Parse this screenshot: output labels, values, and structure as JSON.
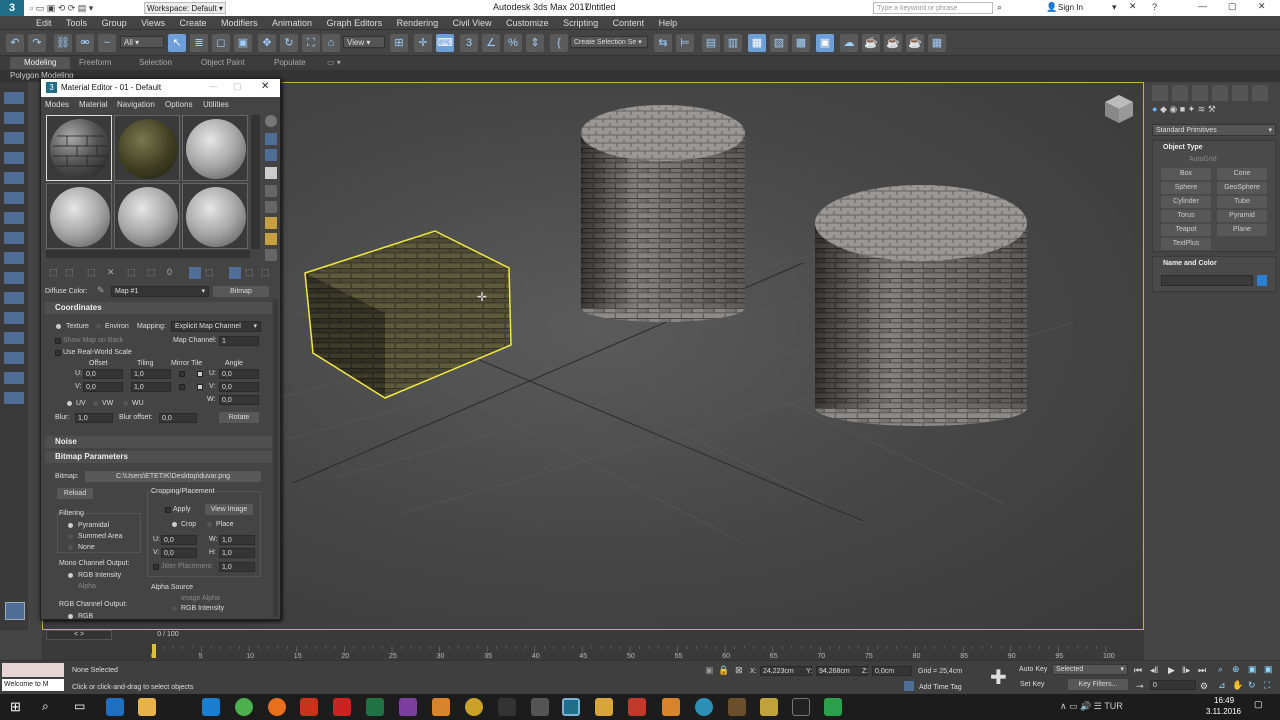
{
  "window": {
    "workspace": "Workspace: Default",
    "app_title": "Autodesk 3ds Max 2017",
    "doc_title": "Untitled",
    "search_placeholder": "Type a keyword or phrase",
    "sign_in": "Sign In"
  },
  "menu": [
    "Edit",
    "Tools",
    "Group",
    "Views",
    "Create",
    "Modifiers",
    "Animation",
    "Graph Editors",
    "Rendering",
    "Civil View",
    "Customize",
    "Scripting",
    "Content",
    "Help"
  ],
  "toolbar": {
    "filter_value": "All",
    "ref_coord": "View",
    "selection_set": "Create Selection Se"
  },
  "ribbon": {
    "tabs": [
      "Modeling",
      "Freeform",
      "Selection",
      "Object Paint",
      "Populate"
    ],
    "sub": "Polygon Modeling"
  },
  "material_editor": {
    "title": "Material Editor - 01 - Default",
    "menus": [
      "Modes",
      "Material",
      "Navigation",
      "Options",
      "Utilities"
    ],
    "diffuse_label": "Diffuse Color:",
    "map_name": "Map #1",
    "map_type": "Bitmap",
    "coordinates": {
      "header": "Coordinates",
      "texture": "Texture",
      "environ": "Environ",
      "mapping_label": "Mapping:",
      "mapping_value": "Explicit Map Channel",
      "show_map_on_back": "Show Map on Back",
      "map_channel_label": "Map Channel:",
      "map_channel_value": "1",
      "use_real_world": "Use Real-World Scale",
      "col_offset": "Offset",
      "col_tiling": "Tiling",
      "col_mirror_tile": "Mirror Tile",
      "col_angle": "Angle",
      "u_label": "U:",
      "v_label": "V:",
      "w_label": "W:",
      "u_offset": "0,0",
      "v_offset": "0,0",
      "u_tiling": "1,0",
      "v_tiling": "1,0",
      "u_angle": "0,0",
      "v_angle": "0,0",
      "w_angle": "0,0",
      "uv": "UV",
      "vw": "VW",
      "wu": "WU",
      "blur_label": "Blur:",
      "blur_value": "1,0",
      "blur_offset_label": "Blur offset:",
      "blur_offset_value": "0,0",
      "rotate": "Rotate"
    },
    "noise_header": "Noise",
    "bitmap_params": {
      "header": "Bitmap Parameters",
      "bitmap_label": "Bitmap:",
      "bitmap_path": "C:\\Users\\ETETIK\\Desktop\\duvar.png",
      "reload": "Reload",
      "cropping": "Cropping/Placement",
      "apply": "Apply",
      "view_image": "View Image",
      "crop": "Crop",
      "place": "Place",
      "filtering": "Filtering",
      "pyramidal": "Pyramidal",
      "summed_area": "Summed Area",
      "none": "None",
      "u_val": "0,0",
      "v_val": "0,0",
      "w_val": "1,0",
      "h_val": "1,0",
      "w_label": "W:",
      "h_label": "H:",
      "jitter": "Jitter Placement:",
      "jitter_val": "1,0",
      "mono_output": "Mono Channel Output:",
      "rgb_intensity": "RGB Intensity",
      "alpha": "Alpha",
      "rgb_output": "RGB Channel Output:",
      "rgb": "RGB",
      "alpha_source": "Alpha Source",
      "image_alpha": "Image Alpha",
      "rgb_intensity2": "RGB Intensity"
    }
  },
  "command_panel": {
    "dropdown": "Standard Primitives",
    "object_type": "Object Type",
    "autogrid": "AutoGrid",
    "buttons": [
      "Box",
      "Cone",
      "Sphere",
      "GeoSphere",
      "Cylinder",
      "Tube",
      "Torus",
      "Pyramid",
      "Teapot",
      "Plane",
      "TextPlus"
    ],
    "name_and_color": "Name and Color",
    "color": "#2f7fd0"
  },
  "timeline": {
    "frame": "0 / 100",
    "ticks": [
      "0",
      "5",
      "10",
      "15",
      "20",
      "25",
      "30",
      "35",
      "40",
      "45",
      "50",
      "55",
      "60",
      "65",
      "70",
      "75",
      "80",
      "85",
      "90",
      "95",
      "100"
    ]
  },
  "status": {
    "script_listener": "Welcome to M",
    "selection": "None Selected",
    "prompt": "Click or click-and-drag to select objects",
    "x_label": "X:",
    "y_label": "Y:",
    "z_label": "Z:",
    "x": "24,223cm",
    "y": "94,268cm",
    "z": "0,0cm",
    "grid": "Grid = 25,4cm",
    "add_time_tag": "Add Time Tag",
    "auto_key": "Auto Key",
    "set_key": "Set Key",
    "selected": "Selected",
    "key_filters": "Key Filters...",
    "frame_value": "0"
  },
  "taskbar": {
    "time": "16:49",
    "date": "3.11.2016"
  }
}
